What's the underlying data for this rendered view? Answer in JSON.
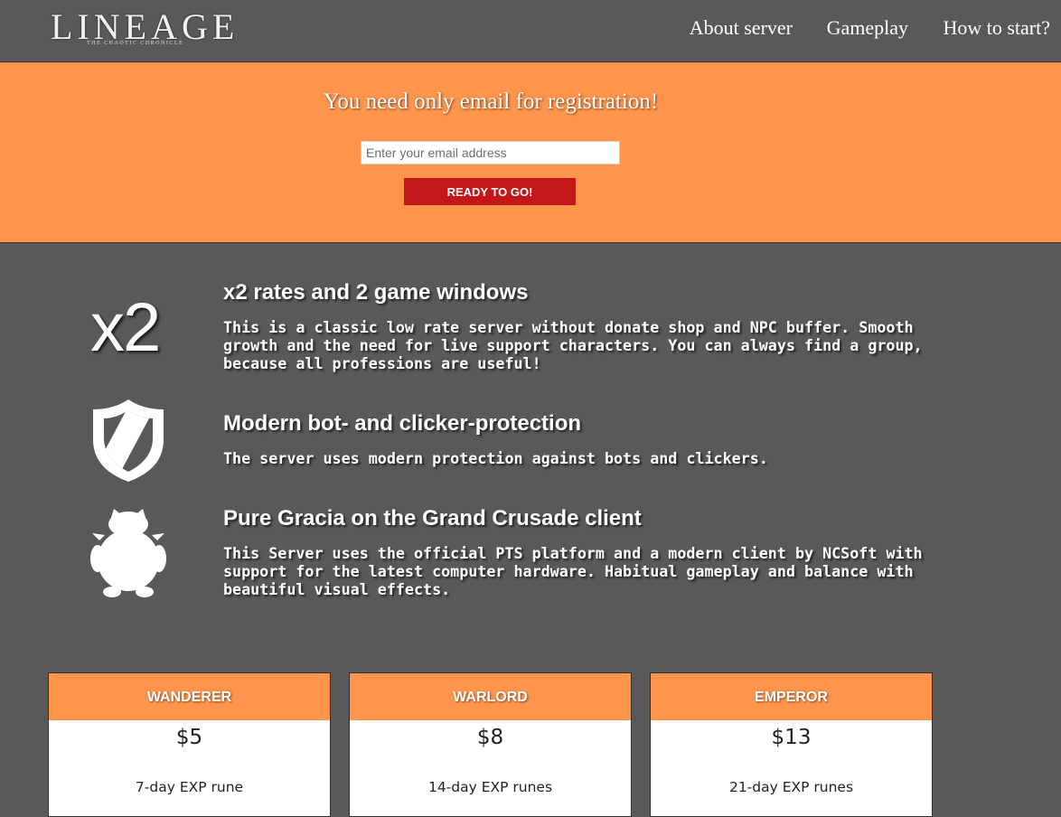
{
  "header": {
    "logo_text": "LINEAGE",
    "logo_subtext": "THE CHAOTIC CHRONICLE",
    "nav": [
      "About server",
      "Gameplay",
      "How to start?"
    ]
  },
  "registration": {
    "title": "You need only email for registration!",
    "email_placeholder": "Enter your email address",
    "button_label": "READY TO GO!"
  },
  "features": [
    {
      "icon_text": "x2",
      "title": "x2 rates and 2 game windows",
      "description": "This is a classic low rate server without donate shop and NPC buffer. Smooth growth and the need for live support characters. You can always find a group, because all professions are useful!"
    },
    {
      "icon": "shield-icon",
      "title": "Modern bot- and clicker-protection",
      "description": "The server uses modern protection against bots and clickers."
    },
    {
      "icon": "creature-icon",
      "title": "Pure Gracia on the Grand Crusade client",
      "description": "This Server uses the official PTS platform and a modern client by NCSoft with support for the latest computer hardware. Habitual gameplay and balance with beautiful visual effects."
    }
  ],
  "plans": [
    {
      "name": "WANDERER",
      "price": "$5",
      "description": "7-day EXP rune"
    },
    {
      "name": "WARLORD",
      "price": "$8",
      "description": "14-day EXP runes"
    },
    {
      "name": "EMPEROR",
      "price": "$13",
      "description": "21-day EXP runes"
    }
  ],
  "colors": {
    "background": "#595959",
    "accent_orange": "#ff944c",
    "button_red": "#c4171a",
    "text_white": "#ffffff"
  }
}
